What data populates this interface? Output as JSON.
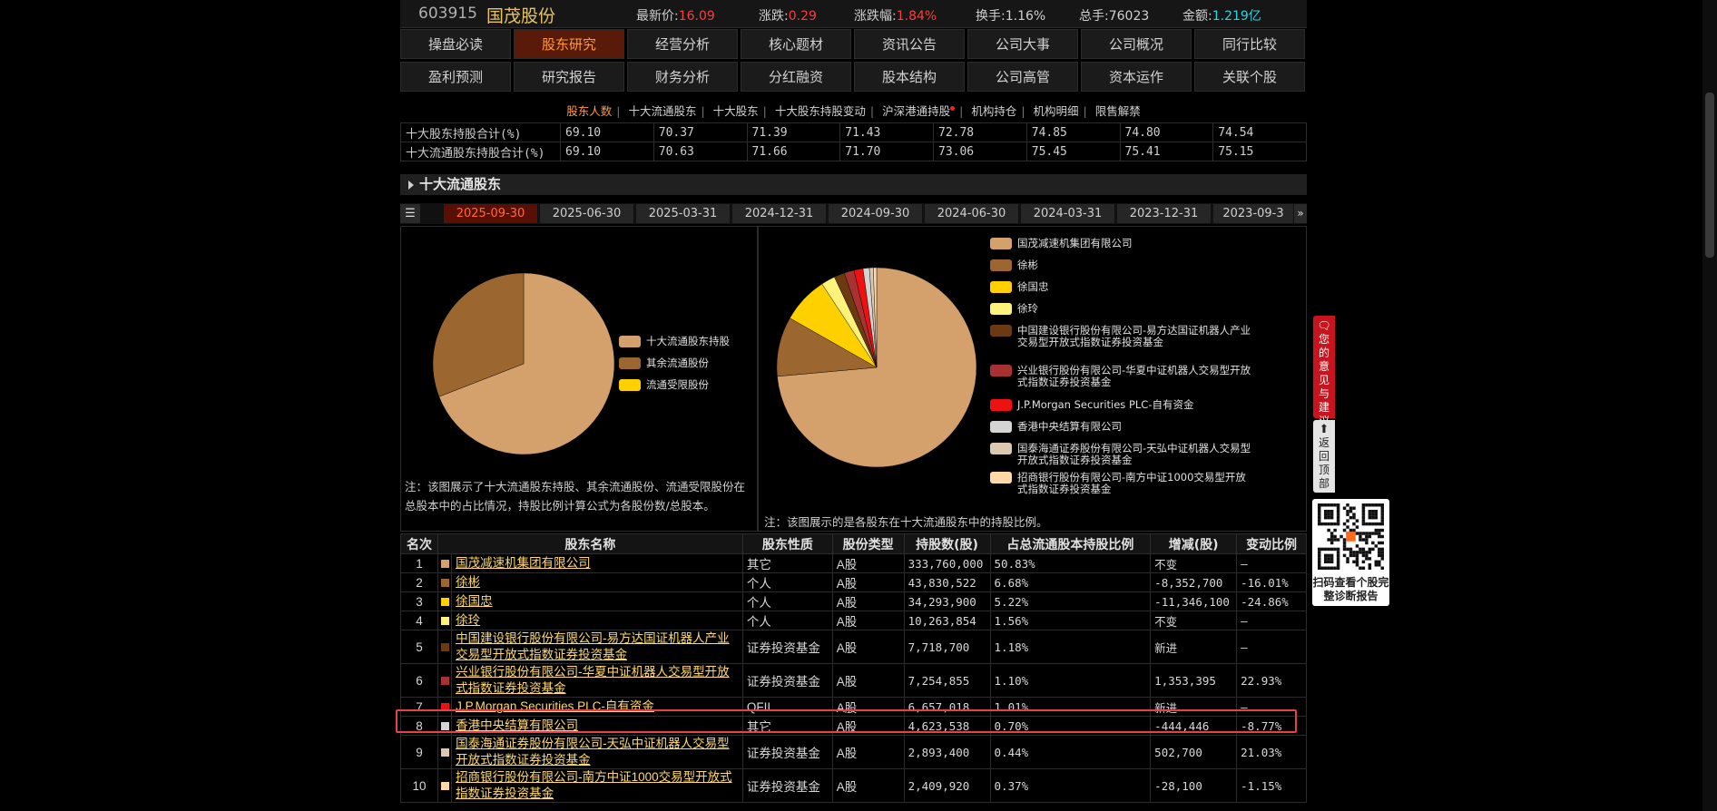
{
  "header": {
    "code": "603915",
    "name": "国茂股份",
    "quotes": [
      {
        "label": "最新价:",
        "value": "16.09",
        "style": "up"
      },
      {
        "label": "涨跌:",
        "value": "0.29",
        "style": "up"
      },
      {
        "label": "涨跌幅:",
        "value": "1.84%",
        "style": "up"
      },
      {
        "label": "换手:",
        "value": "1.16%",
        "style": "plain"
      },
      {
        "label": "总手:",
        "value": "76023",
        "style": "plain"
      },
      {
        "label": "金额:",
        "value": "1.219亿",
        "style": "cyan"
      }
    ]
  },
  "nav_row1": [
    "操盘必读",
    "股东研究",
    "经营分析",
    "核心题材",
    "资讯公告",
    "公司大事",
    "公司概况",
    "同行比较"
  ],
  "nav_row2": [
    "盈利预测",
    "研究报告",
    "财务分析",
    "分红融资",
    "股本结构",
    "公司高管",
    "资本运作",
    "关联个股"
  ],
  "nav_active": "股东研究",
  "subnav": [
    "股东人数",
    "十大流通股东",
    "十大股东",
    "十大股东持股变动",
    "沪深港通持股",
    "机构持仓",
    "机构明细",
    "限售解禁"
  ],
  "subnav_active": "股东人数",
  "summary_rows": [
    {
      "label": "十大股东持股合计(%)",
      "values": [
        "69.10",
        "70.37",
        "71.39",
        "71.43",
        "72.78",
        "74.85",
        "74.80",
        "74.54"
      ]
    },
    {
      "label": "十大流通股东持股合计(%)",
      "values": [
        "69.10",
        "70.63",
        "71.66",
        "71.70",
        "73.06",
        "75.45",
        "75.41",
        "75.15"
      ]
    }
  ],
  "section_title": "十大流通股东",
  "date_tabs": [
    "2025-09-30",
    "2025-06-30",
    "2025-03-31",
    "2024-12-31",
    "2024-09-30",
    "2024-06-30",
    "2024-03-31",
    "2023-12-31",
    "2023-09-3"
  ],
  "date_active": "2025-09-30",
  "pie1": {
    "legend": [
      {
        "name": "十大流通股东持股",
        "color": "#d4a06c"
      },
      {
        "name": "其余流通股份",
        "color": "#9b6630"
      },
      {
        "name": "流通受限股份",
        "color": "#ffd000"
      }
    ],
    "note": "注：该图展示了十大流通股东持股、其余流通股份、流通受限股份在总股本中的占比情况，持股比例计算公式为各股份数/总股本。"
  },
  "pie2": {
    "legend": [
      {
        "name": "国茂减速机集团有限公司",
        "color": "#d4a06c"
      },
      {
        "name": "徐彬",
        "color": "#9b6630"
      },
      {
        "name": "徐国忠",
        "color": "#ffd000"
      },
      {
        "name": "徐玲",
        "color": "#fff27a"
      },
      {
        "name": "中国建设银行股份有限公司-易方达国证机器人产业交易型开放式指数证券投资基金",
        "color": "#6b3a10"
      },
      {
        "name": "兴业银行股份有限公司-华夏中证机器人交易型开放式指数证券投资基金",
        "color": "#a83232"
      },
      {
        "name": "J.P.Morgan Securities PLC-自有资金",
        "color": "#ee1111"
      },
      {
        "name": "香港中央结算有限公司",
        "color": "#d4d4d4"
      },
      {
        "name": "国泰海通证券股份有限公司-天弘中证机器人交易型开放式指数证券投资基金",
        "color": "#dcc8b0"
      },
      {
        "name": "招商银行股份有限公司-南方中证1000交易型开放式指数证券投资基金",
        "color": "#ffd8a8"
      }
    ],
    "note": "注：该图展示的是各股东在十大流通股东中的持股比例。"
  },
  "chart_data": [
    {
      "type": "pie",
      "categories": [
        "十大流通股东持股",
        "其余流通股份",
        "流通受限股份"
      ],
      "values": [
        69.1,
        30.9,
        0.0
      ]
    },
    {
      "type": "pie",
      "categories": [
        "国茂减速机集团有限公司",
        "徐彬",
        "徐国忠",
        "徐玲",
        "中国建设银行股份有限公司-易方达国证机器人产业交易型开放式指数证券投资基金",
        "兴业银行股份有限公司-华夏中证机器人交易型开放式指数证券投资基金",
        "J.P.Morgan Securities PLC-自有资金",
        "香港中央结算有限公司",
        "国泰海通证券股份有限公司-天弘中证机器人交易型开放式指数证券投资基金",
        "招商银行股份有限公司-南方中证1000交易型开放式指数证券投资基金"
      ],
      "values": [
        333760000,
        43830522,
        34293900,
        10263854,
        7718700,
        7254855,
        6657018,
        4623538,
        2893400,
        2409920
      ]
    }
  ],
  "table": {
    "headers": [
      "名次",
      "股东名称",
      "股东性质",
      "股份类型",
      "持股数(股)",
      "占总流通股本持股比例",
      "增减(股)",
      "变动比例"
    ],
    "rows": [
      {
        "rank": "1",
        "color": "#d4a06c",
        "name": "国茂减速机集团有限公司",
        "nature": "其它",
        "type": "A股",
        "shares": "333,760,000",
        "ratio": "50.83%",
        "change": "不变",
        "change_style": "plain",
        "pct": "—",
        "pct_style": "plain"
      },
      {
        "rank": "2",
        "color": "#9b6630",
        "name": "徐彬",
        "nature": "个人",
        "type": "A股",
        "shares": "43,830,522",
        "ratio": "6.68%",
        "change": "-8,352,700",
        "change_style": "neg",
        "pct": "-16.01%",
        "pct_style": "neg"
      },
      {
        "rank": "3",
        "color": "#ffd000",
        "name": "徐国忠",
        "nature": "个人",
        "type": "A股",
        "shares": "34,293,900",
        "ratio": "5.22%",
        "change": "-11,346,100",
        "change_style": "neg",
        "pct": "-24.86%",
        "pct_style": "neg"
      },
      {
        "rank": "4",
        "color": "#fff27a",
        "name": "徐玲",
        "nature": "个人",
        "type": "A股",
        "shares": "10,263,854",
        "ratio": "1.56%",
        "change": "不变",
        "change_style": "plain",
        "pct": "—",
        "pct_style": "plain"
      },
      {
        "rank": "5",
        "color": "#6b3a10",
        "name": "中国建设银行股份有限公司-易方达国证机器人产业交易型开放式指数证券投资基金",
        "nature": "证券投资基金",
        "type": "A股",
        "shares": "7,718,700",
        "ratio": "1.18%",
        "change": "新进",
        "change_style": "pos",
        "pct": "—",
        "pct_style": "pos"
      },
      {
        "rank": "6",
        "color": "#a83232",
        "name": "兴业银行股份有限公司-华夏中证机器人交易型开放式指数证券投资基金",
        "nature": "证券投资基金",
        "type": "A股",
        "shares": "7,254,855",
        "ratio": "1.10%",
        "change": "1,353,395",
        "change_style": "pos",
        "pct": "22.93%",
        "pct_style": "pos"
      },
      {
        "rank": "7",
        "color": "#ee1111",
        "name": "J.P.Morgan Securities PLC-自有资金",
        "nature": "QFII",
        "type": "A股",
        "shares": "6,657,018",
        "ratio": "1.01%",
        "change": "新进",
        "change_style": "pos",
        "pct": "—",
        "pct_style": "pos"
      },
      {
        "rank": "8",
        "color": "#d4d4d4",
        "name": "香港中央结算有限公司",
        "nature": "其它",
        "type": "A股",
        "shares": "4,623,538",
        "ratio": "0.70%",
        "change": "-444,446",
        "change_style": "neg",
        "pct": "-8.77%",
        "pct_style": "neg"
      },
      {
        "rank": "9",
        "color": "#dcc8b0",
        "name": "国泰海通证券股份有限公司-天弘中证机器人交易型开放式指数证券投资基金",
        "nature": "证券投资基金",
        "type": "A股",
        "shares": "2,893,400",
        "ratio": "0.44%",
        "change": "502,700",
        "change_style": "pos",
        "pct": "21.03%",
        "pct_style": "pos"
      },
      {
        "rank": "10",
        "color": "#ffd8a8",
        "name": "招商银行股份有限公司-南方中证1000交易型开放式指数证券投资基金",
        "nature": "证券投资基金",
        "type": "A股",
        "shares": "2,409,920",
        "ratio": "0.37%",
        "change": "-28,100",
        "change_style": "neg",
        "pct": "-1.15%",
        "pct_style": "neg"
      }
    ]
  },
  "sidebar": {
    "feedback": "您的意见与建议",
    "back_to_top": "返回顶部",
    "qr_text": "扫码查看个股完整诊断报告"
  }
}
